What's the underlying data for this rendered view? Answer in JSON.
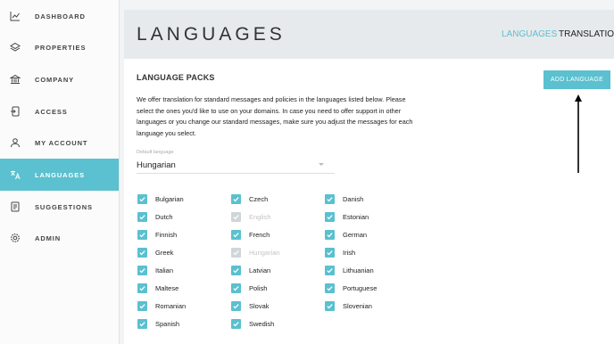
{
  "sidebar": {
    "items": [
      {
        "label": "DASHBOARD",
        "icon": "chart-icon",
        "active": false
      },
      {
        "label": "PROPERTIES",
        "icon": "layers-icon",
        "active": false
      },
      {
        "label": "COMPANY",
        "icon": "bank-icon",
        "active": false
      },
      {
        "label": "ACCESS",
        "icon": "login-icon",
        "active": false
      },
      {
        "label": "MY ACCOUNT",
        "icon": "user-icon",
        "active": false
      },
      {
        "label": "LANGUAGES",
        "icon": "translate-icon",
        "active": true
      },
      {
        "label": "SUGGESTIONS",
        "icon": "document-icon",
        "active": false
      },
      {
        "label": "ADMIN",
        "icon": "gear-icon",
        "active": false
      }
    ]
  },
  "header": {
    "title": "LANGUAGES",
    "tabs": [
      {
        "label": "LANGUAGES",
        "active": true
      },
      {
        "label": "TRANSLATION",
        "active": false
      }
    ]
  },
  "main": {
    "section_title": "LANGUAGE PACKS",
    "add_button": "ADD LANGUAGE",
    "description": "We offer translation for standard messages and policies in the languages listed below. Please select the ones you'd like to use on your domains. In case you need to offer support in other languages or you change our standard messages, make sure you adjust the messages for each language you select.",
    "default_language": {
      "label": "Default language",
      "value": "Hungarian"
    },
    "languages": [
      {
        "name": "Bulgarian",
        "checked": true,
        "disabled": false
      },
      {
        "name": "Czech",
        "checked": true,
        "disabled": false
      },
      {
        "name": "Danish",
        "checked": true,
        "disabled": false
      },
      {
        "name": "Dutch",
        "checked": true,
        "disabled": false
      },
      {
        "name": "English",
        "checked": true,
        "disabled": true
      },
      {
        "name": "Estonian",
        "checked": true,
        "disabled": false
      },
      {
        "name": "Finnish",
        "checked": true,
        "disabled": false
      },
      {
        "name": "French",
        "checked": true,
        "disabled": false
      },
      {
        "name": "German",
        "checked": true,
        "disabled": false
      },
      {
        "name": "Greek",
        "checked": true,
        "disabled": false
      },
      {
        "name": "Hungarian",
        "checked": true,
        "disabled": true
      },
      {
        "name": "Irish",
        "checked": true,
        "disabled": false
      },
      {
        "name": "Italian",
        "checked": true,
        "disabled": false
      },
      {
        "name": "Latvian",
        "checked": true,
        "disabled": false
      },
      {
        "name": "Lithuanian",
        "checked": true,
        "disabled": false
      },
      {
        "name": "Maltese",
        "checked": true,
        "disabled": false
      },
      {
        "name": "Polish",
        "checked": true,
        "disabled": false
      },
      {
        "name": "Portuguese",
        "checked": true,
        "disabled": false
      },
      {
        "name": "Romanian",
        "checked": true,
        "disabled": false
      },
      {
        "name": "Slovak",
        "checked": true,
        "disabled": false
      },
      {
        "name": "Slovenian",
        "checked": true,
        "disabled": false
      },
      {
        "name": "Spanish",
        "checked": true,
        "disabled": false
      },
      {
        "name": "Swedish",
        "checked": true,
        "disabled": false
      }
    ]
  },
  "colors": {
    "accent": "#5bc0cf",
    "disabled_check": "#cfd6d8",
    "header_bg": "#e7eaec"
  }
}
